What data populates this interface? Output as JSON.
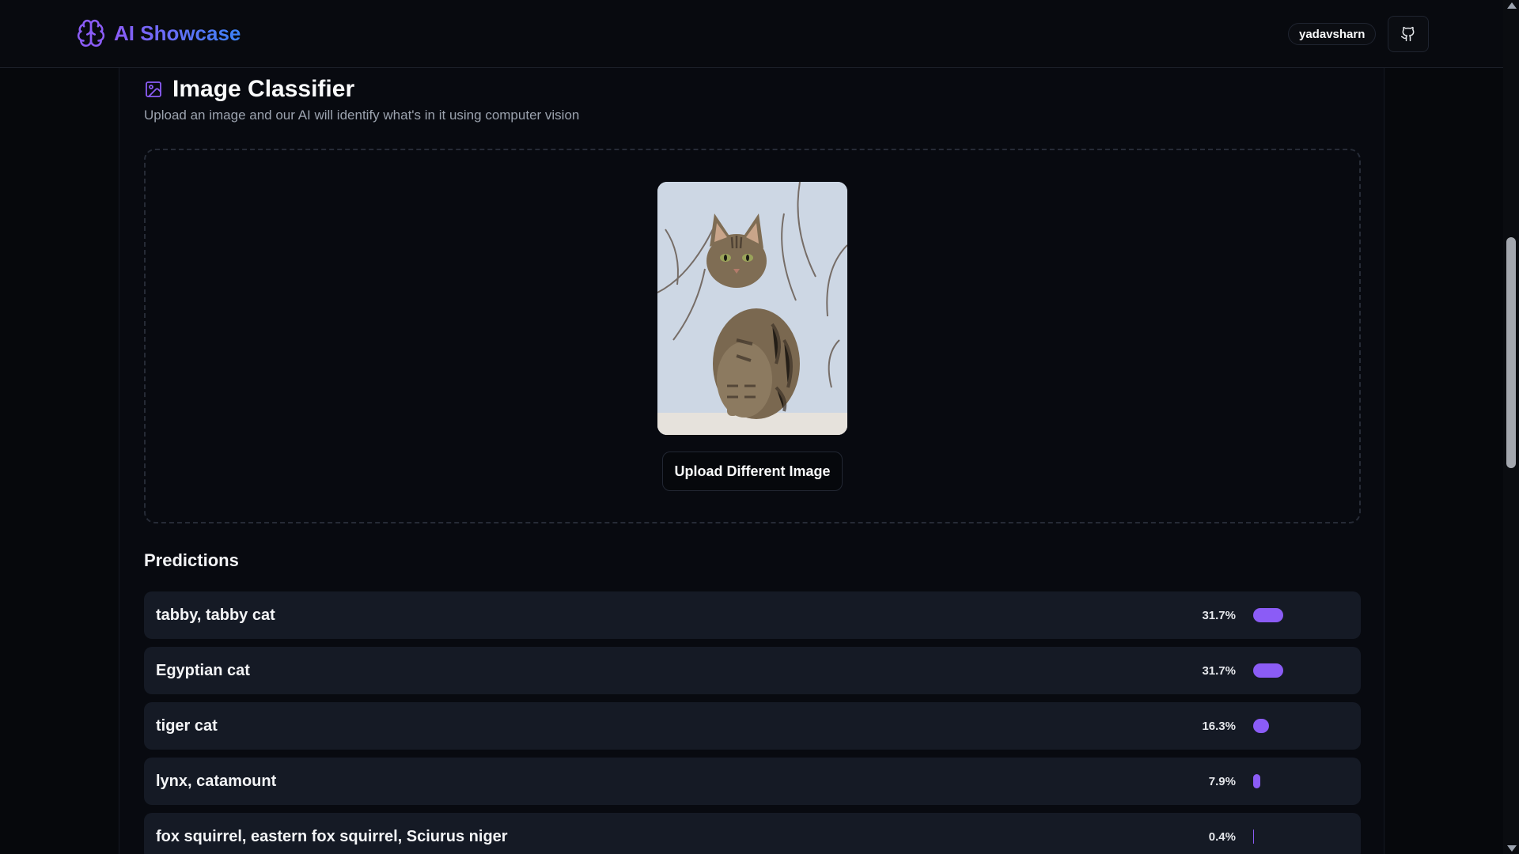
{
  "header": {
    "brand_title": "AI Showcase",
    "brand_icon": "brain-icon",
    "user_name": "yadavsharn",
    "github_icon": "github-icon"
  },
  "classifier": {
    "title_icon": "image-icon",
    "title": "Image Classifier",
    "subtitle": "Upload an image and our AI will identify what's in it using computer vision",
    "upload_button_label": "Upload Different Image"
  },
  "predictions": {
    "heading": "Predictions",
    "items": [
      {
        "label": "tabby, tabby cat",
        "percent_text": "31.7%",
        "value": 0.317
      },
      {
        "label": "Egyptian cat",
        "percent_text": "31.7%",
        "value": 0.317
      },
      {
        "label": "tiger cat",
        "percent_text": "16.3%",
        "value": 0.163
      },
      {
        "label": "lynx, catamount",
        "percent_text": "7.9%",
        "value": 0.079
      },
      {
        "label": "fox squirrel, eastern fox squirrel, Sciurus niger",
        "percent_text": "0.4%",
        "value": 0.004
      }
    ]
  },
  "colors": {
    "accent": "#8b5cf6",
    "brand_gradient_end": "#3b82f6"
  }
}
